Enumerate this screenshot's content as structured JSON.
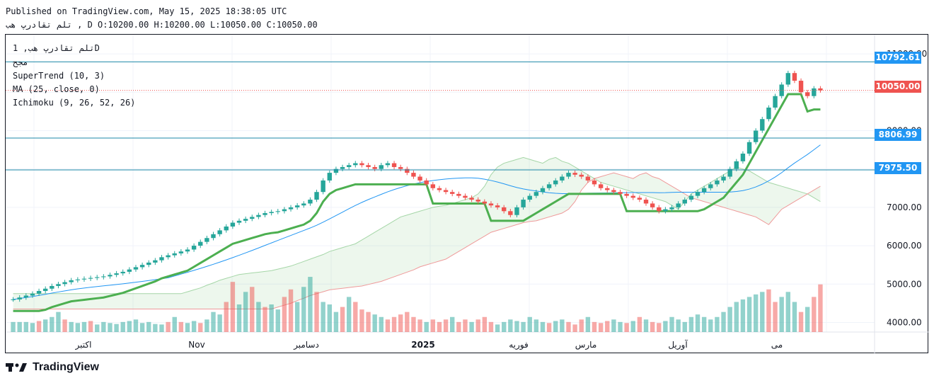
{
  "header": {
    "published": "Published on TradingView.com, May 15, 2025 18:38:05 UTC",
    "ohlc_line": "تلم تقادرپ هب , D O:10200.00 H:10200.00 L:10050.00 C:10050.00"
  },
  "legend": {
    "symbol": "تلم تقادرپ هب, 1D",
    "volume": "مجح",
    "supertrend": "SuperTrend (10, 3)",
    "ma": "MA (25, close, 0)",
    "ichimoku": "Ichimoku (9, 26, 52, 26)"
  },
  "price_tags": [
    {
      "label": "10792.61",
      "color": "#2196f3"
    },
    {
      "label": "10050.00",
      "color": "#ef5350"
    },
    {
      "label": "8806.99",
      "color": "#2196f3"
    },
    {
      "label": "7975.50",
      "color": "#2196f3"
    }
  ],
  "price_axis": [
    "11000.00",
    "9000.00",
    "7000.00",
    "6000.00",
    "5000.00",
    "4000.00"
  ],
  "time_axis": [
    "اکتبر",
    "Nov",
    "دسامبر",
    "2025",
    "فوریه",
    "مارس",
    "آوریل",
    "می"
  ],
  "brand": "TradingView",
  "colors": {
    "up": "#26a69a",
    "down": "#ef5350",
    "supertrend_up": "#4caf50",
    "supertrend_down": "#a0524f",
    "ma": "#2196f3"
  },
  "chart_data": {
    "type": "candlestick",
    "horizontal_lines": [
      10792.61,
      8806.99,
      7975.5
    ],
    "last_price": 10050.0,
    "ylim": [
      3750,
      11500
    ],
    "ohlc_approx": [
      {
        "period": "May 2025 last",
        "open": 10200.0,
        "high": 10200.0,
        "low": 10050.0,
        "close": 10050.0
      }
    ],
    "close_series": [
      4600,
      4650,
      4700,
      4750,
      4820,
      4880,
      4950,
      5000,
      5050,
      5100,
      5120,
      5140,
      5160,
      5180,
      5200,
      5240,
      5280,
      5320,
      5380,
      5440,
      5500,
      5560,
      5620,
      5700,
      5750,
      5800,
      5850,
      5900,
      6000,
      6100,
      6200,
      6300,
      6400,
      6500,
      6600,
      6650,
      6700,
      6750,
      6800,
      6850,
      6880,
      6900,
      6950,
      7000,
      7050,
      7100,
      7200,
      7400,
      7700,
      7900,
      8000,
      8050,
      8100,
      8150,
      8100,
      8050,
      8000,
      8100,
      8150,
      8050,
      8000,
      7900,
      7800,
      7700,
      7600,
      7500,
      7450,
      7400,
      7350,
      7300,
      7250,
      7200,
      7150,
      7100,
      7050,
      7000,
      6900,
      6800,
      7000,
      7200,
      7300,
      7400,
      7500,
      7600,
      7700,
      7800,
      7900,
      7850,
      7800,
      7700,
      7600,
      7500,
      7450,
      7400,
      7350,
      7300,
      7250,
      7200,
      7100,
      7000,
      6900,
      6950,
      7000,
      7100,
      7200,
      7300,
      7400,
      7500,
      7600,
      7700,
      7800,
      8000,
      8200,
      8400,
      8700,
      9000,
      9300,
      9600,
      9900,
      10200,
      10500,
      10300,
      10000,
      9900,
      10100,
      10050
    ],
    "volume_series": [
      20,
      20,
      20,
      18,
      22,
      25,
      30,
      40,
      25,
      20,
      18,
      20,
      22,
      15,
      20,
      18,
      16,
      20,
      22,
      25,
      18,
      20,
      16,
      15,
      20,
      30,
      20,
      18,
      22,
      18,
      25,
      40,
      35,
      60,
      100,
      55,
      80,
      90,
      60,
      50,
      55,
      45,
      70,
      85,
      60,
      90,
      110,
      80,
      60,
      55,
      40,
      50,
      70,
      60,
      45,
      40,
      35,
      30,
      25,
      30,
      35,
      40,
      30,
      25,
      20,
      25,
      20,
      25,
      30,
      20,
      25,
      20,
      25,
      30,
      20,
      15,
      20,
      25,
      22,
      20,
      30,
      25,
      20,
      18,
      22,
      25,
      20,
      15,
      25,
      30,
      20,
      18,
      22,
      25,
      20,
      18,
      22,
      30,
      25,
      20,
      18,
      22,
      30,
      25,
      20,
      30,
      35,
      30,
      25,
      30,
      40,
      50,
      60,
      65,
      70,
      75,
      80,
      85,
      60,
      70,
      80,
      60,
      40,
      50,
      70,
      95
    ],
    "volume_direction": [
      1,
      1,
      1,
      1,
      -1,
      1,
      1,
      1,
      -1,
      1,
      1,
      1,
      -1,
      1,
      1,
      1,
      1,
      1,
      1,
      1,
      1,
      1,
      1,
      1,
      -1,
      1,
      -1,
      1,
      1,
      -1,
      1,
      1,
      1,
      -1,
      -1,
      1,
      1,
      -1,
      1,
      -1,
      1,
      1,
      -1,
      -1,
      1,
      1,
      1,
      -1,
      1,
      1,
      1,
      -1,
      1,
      -1,
      -1,
      -1,
      1,
      1,
      -1,
      -1,
      -1,
      -1,
      -1,
      -1,
      1,
      -1,
      -1,
      -1,
      1,
      -1,
      -1,
      1,
      -1,
      -1,
      -1,
      1,
      1,
      1,
      1,
      1,
      1,
      1,
      1,
      -1,
      1,
      1,
      -1,
      -1,
      -1,
      1,
      -1,
      -1,
      -1,
      1,
      1,
      -1,
      1,
      -1,
      1,
      -1,
      -1,
      1,
      1,
      1,
      1,
      1,
      1,
      1,
      1,
      1,
      1,
      1,
      1,
      1,
      1,
      1,
      1,
      -1,
      -1,
      1,
      1,
      1,
      -1,
      1,
      -1
    ]
  }
}
